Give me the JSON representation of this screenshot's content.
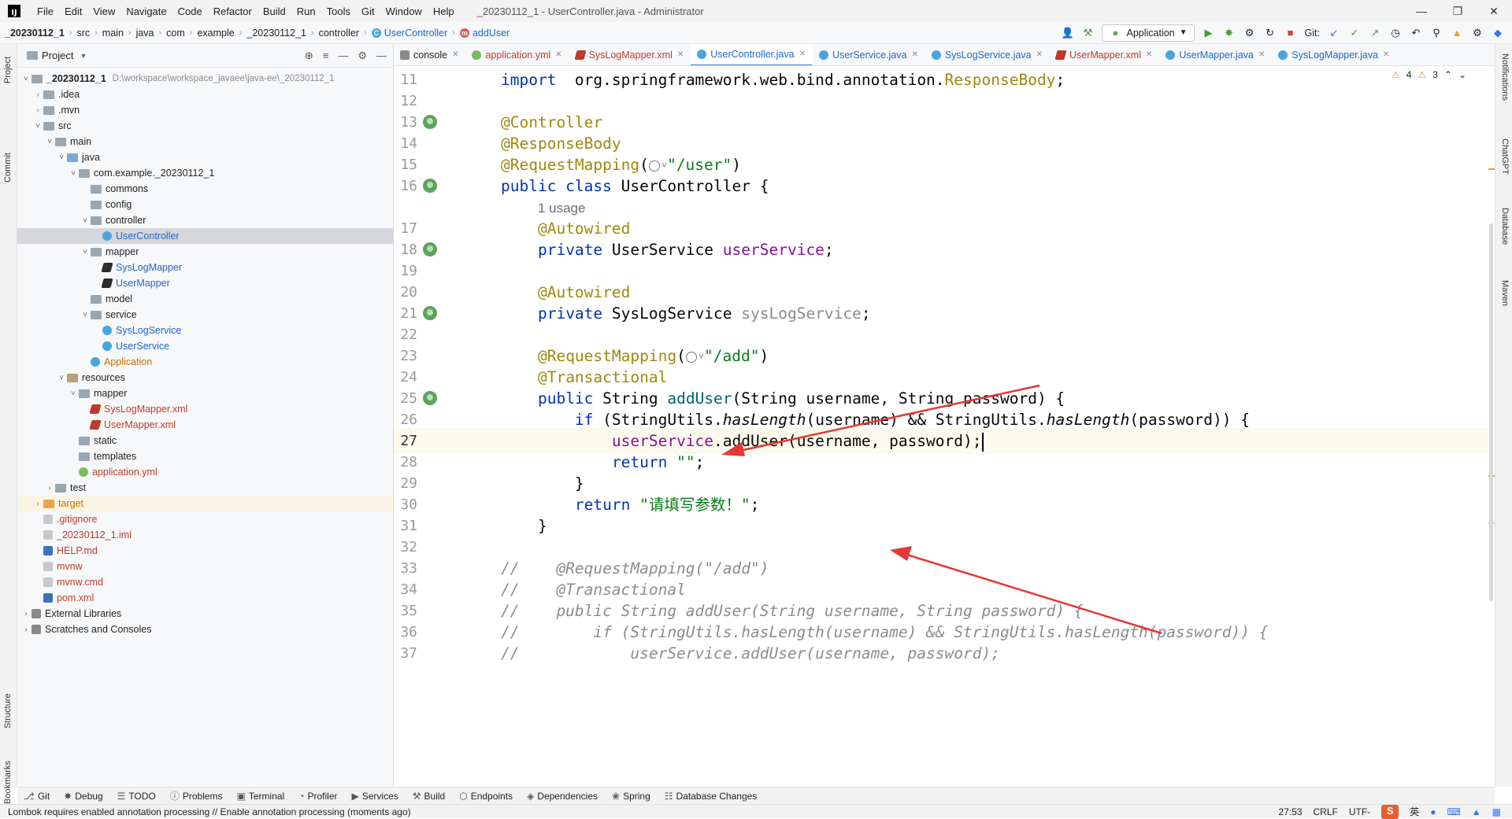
{
  "window": {
    "title": "_20230112_1 - UserController.java - Administrator",
    "menu": [
      "File",
      "Edit",
      "View",
      "Navigate",
      "Code",
      "Refactor",
      "Build",
      "Run",
      "Tools",
      "Git",
      "Window",
      "Help"
    ]
  },
  "breadcrumb": [
    "_20230112_1",
    "src",
    "main",
    "java",
    "com",
    "example",
    "_20230112_1",
    "controller",
    "UserController",
    "addUser"
  ],
  "toolbar": {
    "run_config": "Application",
    "git_label": "Git:"
  },
  "left_strip": {
    "project": "Project",
    "commit": "Commit",
    "structure": "Structure",
    "bookmarks": "Bookmarks"
  },
  "right_strip": {
    "notifications": "Notifications",
    "chatgpt": "ChatGPT",
    "database": "Database",
    "maven": "Maven"
  },
  "project_panel": {
    "title": "Project",
    "tree": [
      {
        "label": "_20230112_1",
        "extra": "D:\\workspace\\workspace_javaee\\java-ee\\_20230112_1",
        "indent": 0,
        "arrow": "v",
        "icon": "folder",
        "bold": true
      },
      {
        "label": ".idea",
        "indent": 1,
        "arrow": ">",
        "icon": "folder"
      },
      {
        "label": ".mvn",
        "indent": 1,
        "arrow": ">",
        "icon": "folder"
      },
      {
        "label": "src",
        "indent": 1,
        "arrow": "v",
        "icon": "folder"
      },
      {
        "label": "main",
        "indent": 2,
        "arrow": "v",
        "icon": "folder"
      },
      {
        "label": "java",
        "indent": 3,
        "arrow": "v",
        "icon": "folder-src"
      },
      {
        "label": "com.example._20230112_1",
        "indent": 4,
        "arrow": "v",
        "icon": "folder-pkg"
      },
      {
        "label": "commons",
        "indent": 5,
        "arrow": "",
        "icon": "folder-pkg"
      },
      {
        "label": "config",
        "indent": 5,
        "arrow": "",
        "icon": "folder-pkg"
      },
      {
        "label": "controller",
        "indent": 5,
        "arrow": "v",
        "icon": "folder-pkg"
      },
      {
        "label": "UserController",
        "indent": 6,
        "arrow": "",
        "icon": "class",
        "color": "blue",
        "selected": true
      },
      {
        "label": "mapper",
        "indent": 5,
        "arrow": "v",
        "icon": "folder-pkg"
      },
      {
        "label": "SysLogMapper",
        "indent": 6,
        "arrow": "",
        "icon": "mapper",
        "color": "blue"
      },
      {
        "label": "UserMapper",
        "indent": 6,
        "arrow": "",
        "icon": "mapper",
        "color": "blue"
      },
      {
        "label": "model",
        "indent": 5,
        "arrow": "",
        "icon": "folder-pkg"
      },
      {
        "label": "service",
        "indent": 5,
        "arrow": "v",
        "icon": "folder-pkg"
      },
      {
        "label": "SysLogService",
        "indent": 6,
        "arrow": "",
        "icon": "class",
        "color": "blue"
      },
      {
        "label": "UserService",
        "indent": 6,
        "arrow": "",
        "icon": "class",
        "color": "blue"
      },
      {
        "label": "Application",
        "indent": 5,
        "arrow": "",
        "icon": "class",
        "color": "orange"
      },
      {
        "label": "resources",
        "indent": 3,
        "arrow": "v",
        "icon": "folder-res"
      },
      {
        "label": "mapper",
        "indent": 4,
        "arrow": "v",
        "icon": "folder"
      },
      {
        "label": "SysLogMapper.xml",
        "indent": 5,
        "arrow": "",
        "icon": "xml",
        "color": "red"
      },
      {
        "label": "UserMapper.xml",
        "indent": 5,
        "arrow": "",
        "icon": "xml",
        "color": "red"
      },
      {
        "label": "static",
        "indent": 4,
        "arrow": "",
        "icon": "folder"
      },
      {
        "label": "templates",
        "indent": 4,
        "arrow": "",
        "icon": "folder"
      },
      {
        "label": "application.yml",
        "indent": 4,
        "arrow": "",
        "icon": "yml",
        "color": "red"
      },
      {
        "label": "test",
        "indent": 2,
        "arrow": ">",
        "icon": "folder"
      },
      {
        "label": "target",
        "indent": 1,
        "arrow": ">",
        "icon": "folder-target",
        "color": "orange",
        "tinted": true
      },
      {
        "label": ".gitignore",
        "indent": 1,
        "arrow": "",
        "icon": "txt",
        "color": "red"
      },
      {
        "label": "_20230112_1.iml",
        "indent": 1,
        "arrow": "",
        "icon": "txt",
        "color": "red"
      },
      {
        "label": "HELP.md",
        "indent": 1,
        "arrow": "",
        "icon": "md",
        "color": "red"
      },
      {
        "label": "mvnw",
        "indent": 1,
        "arrow": "",
        "icon": "txt",
        "color": "red"
      },
      {
        "label": "mvnw.cmd",
        "indent": 1,
        "arrow": "",
        "icon": "txt",
        "color": "red"
      },
      {
        "label": "pom.xml",
        "indent": 1,
        "arrow": "",
        "icon": "md",
        "color": "red"
      },
      {
        "label": "External Libraries",
        "indent": 0,
        "arrow": ">",
        "icon": "lib"
      },
      {
        "label": "Scratches and Consoles",
        "indent": 0,
        "arrow": ">",
        "icon": "lib"
      }
    ]
  },
  "tabs": [
    {
      "label": "console",
      "color": "",
      "active": false
    },
    {
      "label": "application.yml",
      "color": "red",
      "active": false
    },
    {
      "label": "SysLogMapper.xml",
      "color": "red",
      "active": false
    },
    {
      "label": "UserController.java",
      "color": "blue",
      "active": true
    },
    {
      "label": "UserService.java",
      "color": "blue",
      "active": false
    },
    {
      "label": "SysLogService.java",
      "color": "blue",
      "active": false
    },
    {
      "label": "UserMapper.xml",
      "color": "red",
      "active": false
    },
    {
      "label": "UserMapper.java",
      "color": "blue",
      "active": false
    },
    {
      "label": "SysLogMapper.java",
      "color": "blue",
      "active": false
    }
  ],
  "editor": {
    "inspections": {
      "warnings": "4",
      "weak": "3"
    },
    "lines": [
      {
        "num": "11",
        "tokens": [
          [
            "kw",
            "import"
          ],
          [
            "",
            "  org.springframework.web.bind.annotation."
          ],
          [
            "ann",
            "ResponseBody"
          ],
          [
            "",
            ";"
          ]
        ]
      },
      {
        "num": "12",
        "tokens": []
      },
      {
        "num": "13",
        "bean": true,
        "tokens": [
          [
            "ann",
            "@Controller"
          ]
        ]
      },
      {
        "num": "14",
        "tokens": [
          [
            "ann",
            "@ResponseBody"
          ]
        ]
      },
      {
        "num": "15",
        "tokens": [
          [
            "ann",
            "@RequestMapping"
          ],
          [
            "",
            "("
          ],
          [
            "globe",
            ""
          ],
          [
            "str",
            "\"/user\""
          ],
          [
            "",
            ")"
          ]
        ]
      },
      {
        "num": "16",
        "bean": true,
        "tokens": [
          [
            "kw",
            "public class "
          ],
          [
            "",
            "UserController {"
          ]
        ]
      },
      {
        "num": "",
        "hint": "1 usage",
        "tokens": []
      },
      {
        "num": "17",
        "tokens": [
          [
            "",
            "    "
          ],
          [
            "ann",
            "@Autowired"
          ]
        ]
      },
      {
        "num": "18",
        "bean": true,
        "tokens": [
          [
            "",
            "    "
          ],
          [
            "kw",
            "private "
          ],
          [
            "",
            "UserService "
          ],
          [
            "fld",
            "userService"
          ],
          [
            "",
            ";"
          ]
        ]
      },
      {
        "num": "19",
        "tokens": []
      },
      {
        "num": "20",
        "tokens": [
          [
            "",
            "    "
          ],
          [
            "ann",
            "@Autowired"
          ]
        ]
      },
      {
        "num": "21",
        "bean": true,
        "tokens": [
          [
            "",
            "    "
          ],
          [
            "kw",
            "private "
          ],
          [
            "",
            "SysLogService "
          ],
          [
            "fldg",
            "sysLogService"
          ],
          [
            "",
            ";"
          ]
        ]
      },
      {
        "num": "22",
        "tokens": []
      },
      {
        "num": "23",
        "tokens": [
          [
            "",
            "    "
          ],
          [
            "ann",
            "@RequestMapping"
          ],
          [
            "",
            "("
          ],
          [
            "globe",
            ""
          ],
          [
            "str",
            "\"/add\""
          ],
          [
            "",
            ")"
          ]
        ]
      },
      {
        "num": "24",
        "tokens": [
          [
            "",
            "    "
          ],
          [
            "ann",
            "@Transactional"
          ]
        ]
      },
      {
        "num": "25",
        "bean": true,
        "tokens": [
          [
            "",
            "    "
          ],
          [
            "kw",
            "public "
          ],
          [
            "",
            "String "
          ],
          [
            "meth",
            "addUser"
          ],
          [
            "",
            "(String username, String password) {"
          ]
        ]
      },
      {
        "num": "26",
        "tokens": [
          [
            "",
            "        "
          ],
          [
            "kw",
            "if "
          ],
          [
            "",
            "(StringUtils."
          ],
          [
            "it",
            "hasLength"
          ],
          [
            "",
            "(username) && StringUtils."
          ],
          [
            "it",
            "hasLength"
          ],
          [
            "",
            "(password)) {"
          ]
        ]
      },
      {
        "num": "27",
        "current": true,
        "tokens": [
          [
            "",
            "            "
          ],
          [
            "fld",
            "userService"
          ],
          [
            "",
            ".addUser(username, password);"
          ],
          [
            "caret",
            ""
          ]
        ]
      },
      {
        "num": "28",
        "tokens": [
          [
            "",
            "            "
          ],
          [
            "kw",
            "return "
          ],
          [
            "str",
            "\"\""
          ],
          [
            "",
            ";"
          ]
        ]
      },
      {
        "num": "29",
        "tokens": [
          [
            "",
            "        }"
          ]
        ]
      },
      {
        "num": "30",
        "tokens": [
          [
            "",
            "        "
          ],
          [
            "kw",
            "return "
          ],
          [
            "str",
            "\"请填写参数！\""
          ],
          [
            "",
            ";"
          ]
        ]
      },
      {
        "num": "31",
        "tokens": [
          [
            "",
            "    }"
          ]
        ]
      },
      {
        "num": "32",
        "tokens": []
      },
      {
        "num": "33",
        "tokens": [
          [
            "cmt",
            "//    @RequestMapping(\"/add\")"
          ]
        ]
      },
      {
        "num": "34",
        "tokens": [
          [
            "cmt",
            "//    @Transactional"
          ]
        ]
      },
      {
        "num": "35",
        "tokens": [
          [
            "cmt",
            "//    public String addUser(String username, String password) {"
          ]
        ]
      },
      {
        "num": "36",
        "tokens": [
          [
            "cmt",
            "//        if (StringUtils.hasLength(username) && StringUtils.hasLength(password)) {"
          ]
        ]
      },
      {
        "num": "37",
        "tokens": [
          [
            "cmt",
            "//            userService.addUser(username, password);"
          ]
        ]
      }
    ]
  },
  "bottom_tools": [
    "Git",
    "Debug",
    "TODO",
    "Problems",
    "Terminal",
    "Profiler",
    "Services",
    "Build",
    "Endpoints",
    "Dependencies",
    "Spring",
    "Database Changes"
  ],
  "status": {
    "message": "Lombok requires enabled annotation processing // Enable annotation processing (moments ago)",
    "position": "27:53",
    "line_sep": "CRLF",
    "encoding": "UTF-",
    "ime": "英"
  },
  "colors": {
    "accent": "#3574f0",
    "annotation_arrow": "#e53935"
  }
}
